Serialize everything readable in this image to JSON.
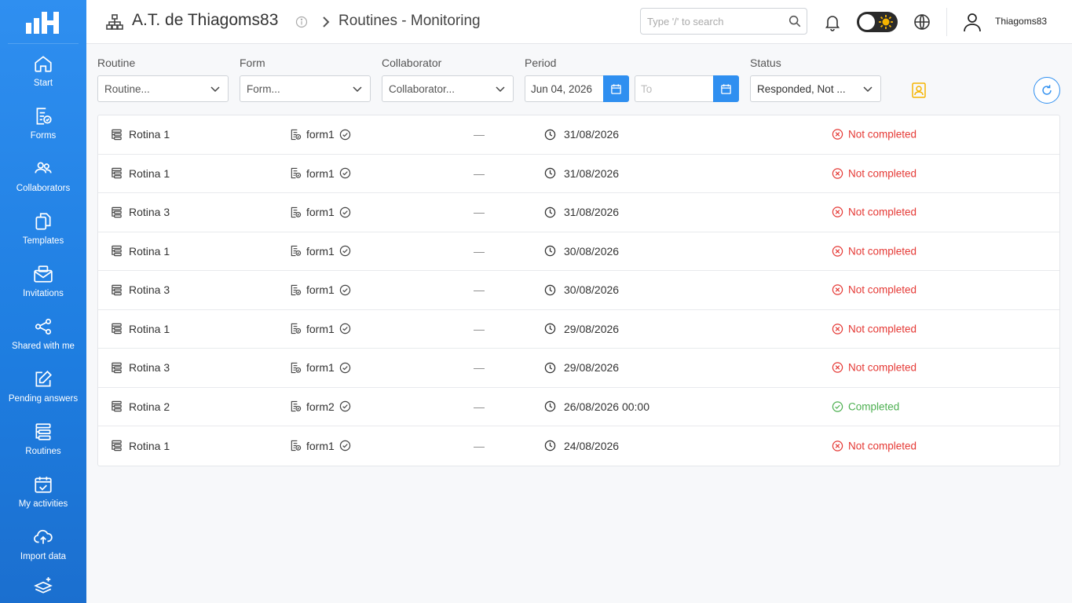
{
  "header": {
    "org_title": "A.T. de Thiagoms83",
    "breadcrumb_page": "Routines - Monitoring",
    "search_placeholder": "Type '/' to search",
    "username": "Thiagoms83"
  },
  "sidebar": {
    "items": [
      {
        "label": "Start",
        "icon": "home-icon"
      },
      {
        "label": "Forms",
        "icon": "forms-icon"
      },
      {
        "label": "Collaborators",
        "icon": "collaborators-icon"
      },
      {
        "label": "Templates",
        "icon": "templates-icon"
      },
      {
        "label": "Invitations",
        "icon": "invitations-icon"
      },
      {
        "label": "Shared with me",
        "icon": "share-icon"
      },
      {
        "label": "Pending answers",
        "icon": "edit-icon"
      },
      {
        "label": "Routines",
        "icon": "routines-icon"
      },
      {
        "label": "My activities",
        "icon": "calendar-check-icon"
      },
      {
        "label": "Import data",
        "icon": "cloud-upload-icon"
      }
    ]
  },
  "filters": {
    "routine": {
      "label": "Routine",
      "value": "Routine..."
    },
    "form": {
      "label": "Form",
      "value": "Form..."
    },
    "collaborator": {
      "label": "Collaborator",
      "value": "Collaborator..."
    },
    "period": {
      "label": "Period",
      "from": "Jun 04, 2026",
      "to_placeholder": "To"
    },
    "status": {
      "label": "Status",
      "value": "Responded, Not ..."
    }
  },
  "rows": [
    {
      "routine": "Rotina 1",
      "form": "form1",
      "collaborator": "—",
      "date": "31/08/2026",
      "status": "Not completed",
      "state": "bad"
    },
    {
      "routine": "Rotina 1",
      "form": "form1",
      "collaborator": "—",
      "date": "31/08/2026",
      "status": "Not completed",
      "state": "bad"
    },
    {
      "routine": "Rotina 3",
      "form": "form1",
      "collaborator": "—",
      "date": "31/08/2026",
      "status": "Not completed",
      "state": "bad"
    },
    {
      "routine": "Rotina 1",
      "form": "form1",
      "collaborator": "—",
      "date": "30/08/2026",
      "status": "Not completed",
      "state": "bad"
    },
    {
      "routine": "Rotina 3",
      "form": "form1",
      "collaborator": "—",
      "date": "30/08/2026",
      "status": "Not completed",
      "state": "bad"
    },
    {
      "routine": "Rotina 1",
      "form": "form1",
      "collaborator": "—",
      "date": "29/08/2026",
      "status": "Not completed",
      "state": "bad"
    },
    {
      "routine": "Rotina 3",
      "form": "form1",
      "collaborator": "—",
      "date": "29/08/2026",
      "status": "Not completed",
      "state": "bad"
    },
    {
      "routine": "Rotina 2",
      "form": "form2",
      "collaborator": "—",
      "date": "26/08/2026 00:00",
      "status": "Completed",
      "state": "good"
    },
    {
      "routine": "Rotina 1",
      "form": "form1",
      "collaborator": "—",
      "date": "24/08/2026",
      "status": "Not completed",
      "state": "bad"
    }
  ],
  "colors": {
    "primary": "#2f8ff0",
    "danger": "#e53935",
    "success": "#4caf50",
    "accent": "#f5b400"
  }
}
